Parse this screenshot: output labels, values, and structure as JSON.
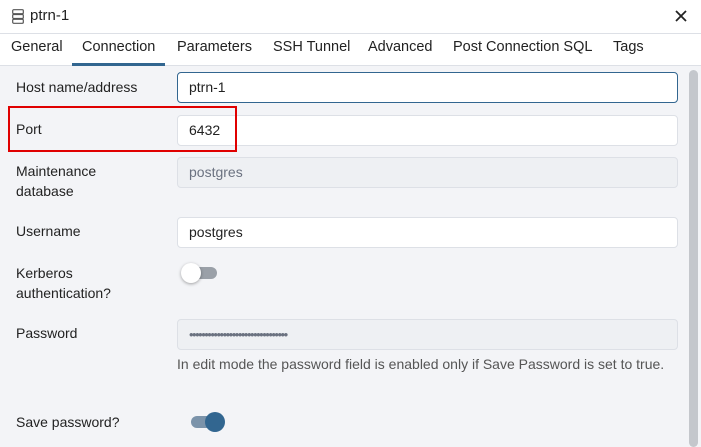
{
  "window": {
    "title": "ptrn-1"
  },
  "tabs": [
    {
      "label": "General"
    },
    {
      "label": "Connection"
    },
    {
      "label": "Parameters"
    },
    {
      "label": "SSH Tunnel"
    },
    {
      "label": "Advanced"
    },
    {
      "label": "Post Connection SQL"
    },
    {
      "label": "Tags"
    }
  ],
  "active_tab": "Connection",
  "form": {
    "host": {
      "label": "Host name/address",
      "value": "ptrn-1"
    },
    "port": {
      "label": "Port",
      "value": "6432"
    },
    "maintenance_db": {
      "label_line1": "Maintenance",
      "label_line2": "database",
      "value": "postgres"
    },
    "username": {
      "label": "Username",
      "value": "postgres"
    },
    "kerberos": {
      "label_line1": "Kerberos",
      "label_line2": "authentication?",
      "enabled": false
    },
    "password": {
      "label": "Password",
      "value": "••••••••••••••••••••••••••••••••"
    },
    "help_text": "In edit mode the password field is enabled only if Save Password is set to true.",
    "save_password": {
      "label": "Save password?",
      "enabled": true
    }
  },
  "colors": {
    "accent": "#326690",
    "highlight": "#e00000",
    "panel_bg": "#f3f4f7"
  },
  "icons": {
    "title": "server-icon",
    "close": "close-icon"
  }
}
